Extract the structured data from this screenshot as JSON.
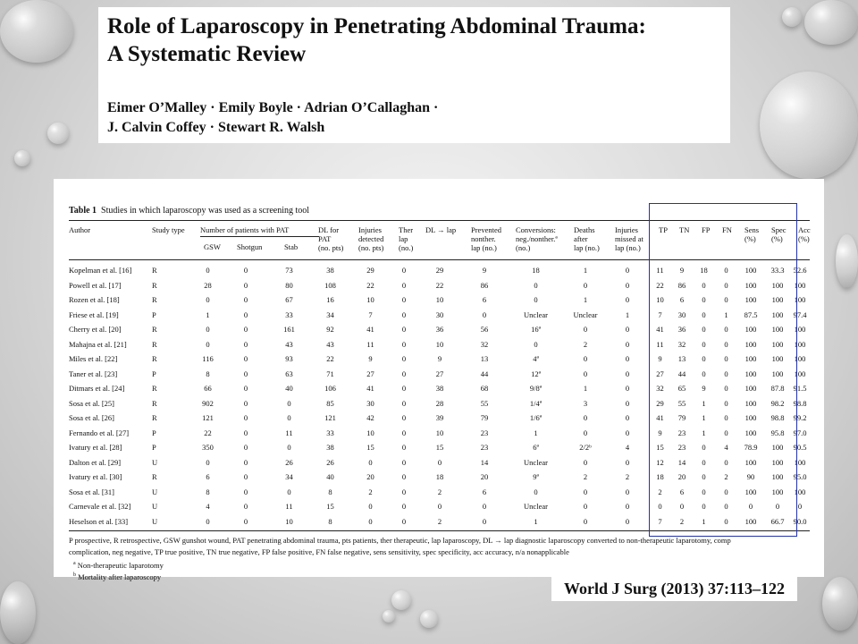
{
  "title": {
    "line1": "Role of Laparoscopy in Penetrating Abdominal Trauma:",
    "line2": "A Systematic Review",
    "authors1": "Eimer O’Malley · Emily Boyle · Adrian O’Callaghan ·",
    "authors2": "J. Calvin Coffey · Stewart R. Walsh"
  },
  "table": {
    "caption_label": "Table 1",
    "caption_text": "Studies in which laparoscopy was used as a screening tool",
    "headers": {
      "author": "Author",
      "study_type": "Study type",
      "num_patients": "Number of patients with PAT",
      "gsw": "GSW",
      "shotgun": "Shotgun",
      "stab": "Stab",
      "dl_for_pat": [
        "DL for",
        "PAT",
        "(no. pts)"
      ],
      "injuries_detected": [
        "Injuries",
        "detected",
        "(no. pts)"
      ],
      "ther_lap": [
        "Ther",
        "lap",
        "(no.)"
      ],
      "dl_lap": "DL → lap",
      "prevented": [
        "Prevented",
        "nonther.",
        "lap (no.)"
      ],
      "conversions": [
        "Conversions:",
        "neg./nonther.ª",
        "(no.)"
      ],
      "deaths": [
        "Deaths",
        "after",
        "lap (no.)"
      ],
      "missed": [
        "Injuries",
        "missed at",
        "lap (no.)"
      ],
      "tp": "TP",
      "tn": "TN",
      "fp": "FP",
      "fn": "FN",
      "sens": [
        "Sens",
        "(%)"
      ],
      "spec": [
        "Spec",
        "(%)"
      ],
      "acc": [
        "Acc",
        "(%)"
      ]
    },
    "rows": [
      [
        "Kopelman et al. [16]",
        "R",
        "0",
        "0",
        "73",
        "38",
        "29",
        "0",
        "29",
        "9",
        "18",
        "1",
        "0",
        "11",
        "9",
        "18",
        "0",
        "100",
        "33.3",
        "52.6"
      ],
      [
        "Powell et al. [17]",
        "R",
        "28",
        "0",
        "80",
        "108",
        "22",
        "0",
        "22",
        "86",
        "0",
        "0",
        "0",
        "22",
        "86",
        "0",
        "0",
        "100",
        "100",
        "100"
      ],
      [
        "Rozen et al. [18]",
        "R",
        "0",
        "0",
        "67",
        "16",
        "10",
        "0",
        "10",
        "6",
        "0",
        "1",
        "0",
        "10",
        "6",
        "0",
        "0",
        "100",
        "100",
        "100"
      ],
      [
        "Friese et al. [19]",
        "P",
        "1",
        "0",
        "33",
        "34",
        "7",
        "0",
        "30",
        "0",
        "Unclear",
        "Unclear",
        "1",
        "7",
        "30",
        "0",
        "1",
        "87.5",
        "100",
        "97.4"
      ],
      [
        "Cherry et al. [20]",
        "R",
        "0",
        "0",
        "161",
        "92",
        "41",
        "0",
        "36",
        "56",
        "16ª",
        "0",
        "0",
        "41",
        "36",
        "0",
        "0",
        "100",
        "100",
        "100"
      ],
      [
        "Mahajna et al. [21]",
        "R",
        "0",
        "0",
        "43",
        "43",
        "11",
        "0",
        "10",
        "32",
        "0",
        "2",
        "0",
        "11",
        "32",
        "0",
        "0",
        "100",
        "100",
        "100"
      ],
      [
        "Miles et al. [22]",
        "R",
        "116",
        "0",
        "93",
        "22",
        "9",
        "0",
        "9",
        "13",
        "4ª",
        "0",
        "0",
        "9",
        "13",
        "0",
        "0",
        "100",
        "100",
        "100"
      ],
      [
        "Taner et al. [23]",
        "P",
        "8",
        "0",
        "63",
        "71",
        "27",
        "0",
        "27",
        "44",
        "12ª",
        "0",
        "0",
        "27",
        "44",
        "0",
        "0",
        "100",
        "100",
        "100"
      ],
      [
        "Ditmars et al. [24]",
        "R",
        "66",
        "0",
        "40",
        "106",
        "41",
        "0",
        "38",
        "68",
        "9/8ª",
        "1",
        "0",
        "32",
        "65",
        "9",
        "0",
        "100",
        "87.8",
        "91.5"
      ],
      [
        "Sosa et al. [25]",
        "R",
        "902",
        "0",
        "0",
        "85",
        "30",
        "0",
        "28",
        "55",
        "1/4ª",
        "3",
        "0",
        "29",
        "55",
        "1",
        "0",
        "100",
        "98.2",
        "98.8"
      ],
      [
        "Sosa et al. [26]",
        "R",
        "121",
        "0",
        "0",
        "121",
        "42",
        "0",
        "39",
        "79",
        "1/6ª",
        "0",
        "0",
        "41",
        "79",
        "1",
        "0",
        "100",
        "98.8",
        "99.2"
      ],
      [
        "Fernando et al. [27]",
        "P",
        "22",
        "0",
        "11",
        "33",
        "10",
        "0",
        "10",
        "23",
        "1",
        "0",
        "0",
        "9",
        "23",
        "1",
        "0",
        "100",
        "95.8",
        "97.0"
      ],
      [
        "Ivatury et al. [28]",
        "P",
        "350",
        "0",
        "0",
        "38",
        "15",
        "0",
        "15",
        "23",
        "6ª",
        "2/2ᵇ",
        "4",
        "15",
        "23",
        "0",
        "4",
        "78.9",
        "100",
        "90.5"
      ],
      [
        "Dalton et al. [29]",
        "U",
        "0",
        "0",
        "26",
        "26",
        "0",
        "0",
        "0",
        "14",
        "Unclear",
        "0",
        "0",
        "12",
        "14",
        "0",
        "0",
        "100",
        "100",
        "100"
      ],
      [
        "Ivatury et al. [30]",
        "R",
        "6",
        "0",
        "34",
        "40",
        "20",
        "0",
        "18",
        "20",
        "9ª",
        "2",
        "2",
        "18",
        "20",
        "0",
        "2",
        "90",
        "100",
        "95.0"
      ],
      [
        "Sosa et al. [31]",
        "U",
        "8",
        "0",
        "0",
        "8",
        "2",
        "0",
        "2",
        "6",
        "0",
        "0",
        "0",
        "2",
        "6",
        "0",
        "0",
        "100",
        "100",
        "100"
      ],
      [
        "Carnevale et al. [32]",
        "U",
        "4",
        "0",
        "11",
        "15",
        "0",
        "0",
        "0",
        "0",
        "Unclear",
        "0",
        "0",
        "0",
        "0",
        "0",
        "0",
        "0",
        "0",
        "0"
      ],
      [
        "Heselson et al. [33]",
        "U",
        "0",
        "0",
        "10",
        "8",
        "0",
        "0",
        "2",
        "0",
        "1",
        "0",
        "0",
        "7",
        "2",
        "1",
        "0",
        "100",
        "66.7",
        "90.0"
      ]
    ],
    "footnote_line1": "P prospective, R retrospective, GSW gunshot wound, PAT penetrating abdominal trauma, pts patients, ther therapeutic, lap laparoscopy, DL → lap diagnostic laparoscopy converted to non-therapeutic laparotomy, comp",
    "footnote_line2": "complication, neg negative, TP true positive, TN true negative, FP false positive, FN false negative, sens sensitivity, spec specificity, acc accuracy, n/a nonapplicable",
    "note_a_mark": "a",
    "note_a": "Non-therapeutic laparotomy",
    "note_b_mark": "b",
    "note_b": "Mortality after laparoscopy"
  },
  "citation": "World J Surg (2013) 37:113–122",
  "colors": {
    "highlight_box": "#2233aa",
    "panel_bg": "#ffffff"
  }
}
